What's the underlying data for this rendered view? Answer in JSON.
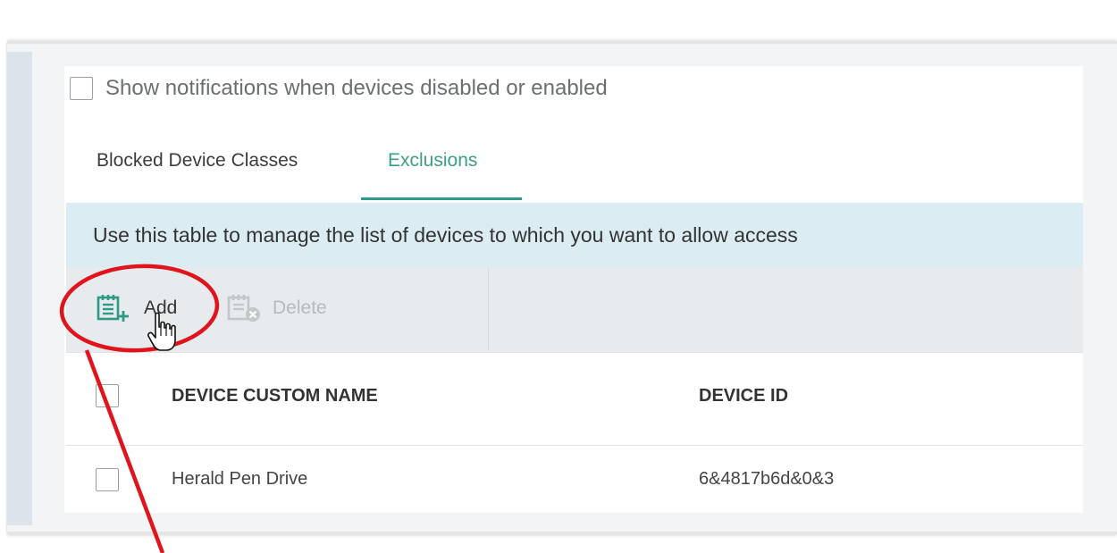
{
  "options": {
    "show_notifications_label": "Show notifications when devices disabled or enabled",
    "show_notifications_checked": false
  },
  "tabs": [
    {
      "label": "Blocked Device Classes",
      "active": false
    },
    {
      "label": "Exclusions",
      "active": true
    }
  ],
  "info_text": "Use this table to manage the list of devices to which you want to allow access",
  "toolbar": {
    "add_label": "Add",
    "delete_label": "Delete",
    "delete_enabled": false
  },
  "table": {
    "columns": [
      "DEVICE CUSTOM NAME",
      "DEVICE ID"
    ],
    "rows": [
      {
        "name": "Herald Pen Drive",
        "device_id": "6&4817b6d&0&3",
        "checked": false
      }
    ]
  },
  "icons": {
    "add": "clipboard-add-icon",
    "delete": "clipboard-delete-icon",
    "cursor": "hand-pointer-icon"
  },
  "colors": {
    "accent": "#2e9a85",
    "info_bar_bg": "#dbecf2",
    "toolbar_bg": "#e8ebee",
    "annotation": "#e0141c"
  }
}
